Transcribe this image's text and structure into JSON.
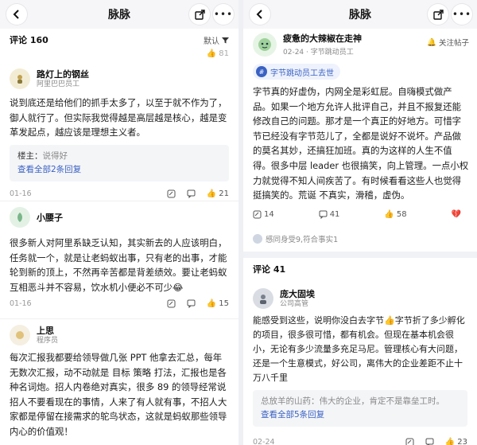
{
  "left": {
    "title": "脉脉",
    "comments_label": "评论 160",
    "sort_label": "默认",
    "top_count": "81",
    "comments": [
      {
        "name": "路灯上的钢丝",
        "role": "阿里巴巴员工",
        "text": "说到底还是给他们的抓手太多了，以至于就不作为了，御人就行了。但实际我觉得越是高层越是核心，越是变革发起点，越应该是理想主义者。",
        "reply_author": "楼主：",
        "reply_text": "说得好",
        "reply_link": "查看全部2条回复",
        "date": "01-16",
        "likes": "21"
      },
      {
        "name": "小腰子",
        "role": "",
        "text": "很多新人对阿里系缺乏认知，其实新去的人应该明白，任务就一个，就是让老蚂蚁出事，只有老的出事，才能轮到新的顶上，不然再辛苦都是背差绩效。要让老蚂蚁互相恶斗并不容易，饮水机小便必不可少😂",
        "date": "01-16",
        "likes": "15"
      },
      {
        "name": "上思",
        "role": "程序员",
        "text": "每次汇报我都要给领导做几张 PPT 他拿去汇总，每年无数次汇报，动不动就是 目标 策略 打法，汇报也是各种名词炮。招人内卷绝对真实，很多 89 的领导经常说招人不要看现在的事情，人来了有人就有事，不招人大家都是停留在接需求的鸵鸟状态，这就是蚂蚁那些领导内心的价值观！"
      }
    ]
  },
  "right": {
    "title": "脉脉",
    "post": {
      "name": "疲惫的大辣椒在走神",
      "meta": "02-24 · 字节跳动员工",
      "follow": "关注帖子",
      "tag": "字节跳动员工去世",
      "body": "字节真的好虚伪，内网全是彩虹屁。自嗨模式做产品。如果一个地方允许人批评自己，并且不报复还能修改自己的问题。那才是一个真正的好地方。可惜字节已经没有字节范儿了，全都是说好不说坏。产品做的莫名其妙，还搞狂加班。真的为这样的人生不值得。很多中层 leader 也很搞笑，向上管理。一点小权力就觉得不知人间疾苦了。有时候看看这些人也觉得挺搞笑的。荒诞 不真实，滑稽，虚伪。",
      "comments_count": "14",
      "shares": "41",
      "likes": "58",
      "views": "感同身受9,符合事实1"
    },
    "comments_label": "评论 41",
    "comment": {
      "name": "庞大固埃",
      "role": "公司高管",
      "text": "能感受到这些，说明你没白去字节👍字节折了多少孵化的项目，很多很可惜，都有机会。但现在基本机会很小，无论有多少流量多充足马尼。管理核心有大问题，还是一个生意模式，好公司，离伟大的企业差距不止十万八千里",
      "reply_author": "总放羊的山药：",
      "reply_text": "伟大的企业，肯定不是靠垒工时。",
      "reply_link": "查看全部5条回复",
      "date": "02-24",
      "likes": "23"
    }
  }
}
